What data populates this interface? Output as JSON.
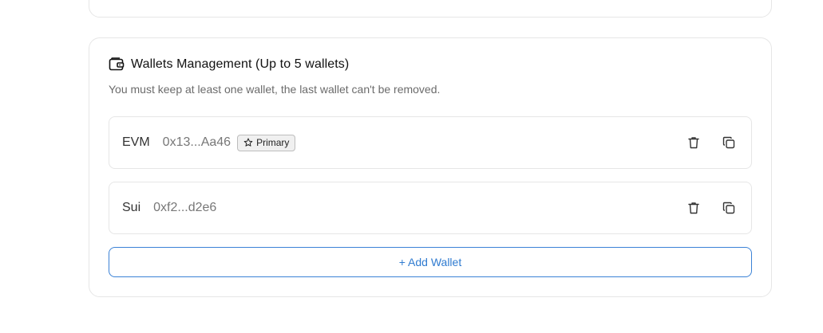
{
  "section": {
    "title": "Wallets Management (Up to 5 wallets)",
    "subtitle": "You must keep at least one wallet, the last wallet can't be removed."
  },
  "wallets": [
    {
      "chain": "EVM",
      "address": "0x13...Aa46",
      "badge": "Primary"
    },
    {
      "chain": "Sui",
      "address": "0xf2...d2e6"
    }
  ],
  "add_wallet_label": "+ Add Wallet",
  "colors": {
    "accent": "#2f7bd0",
    "border": "#e6e6e6",
    "muted_text": "#6b6b6b"
  },
  "icons": {
    "header": "wallet-icon",
    "badge": "star-icon",
    "delete": "trash-icon",
    "copy": "copy-icon"
  }
}
